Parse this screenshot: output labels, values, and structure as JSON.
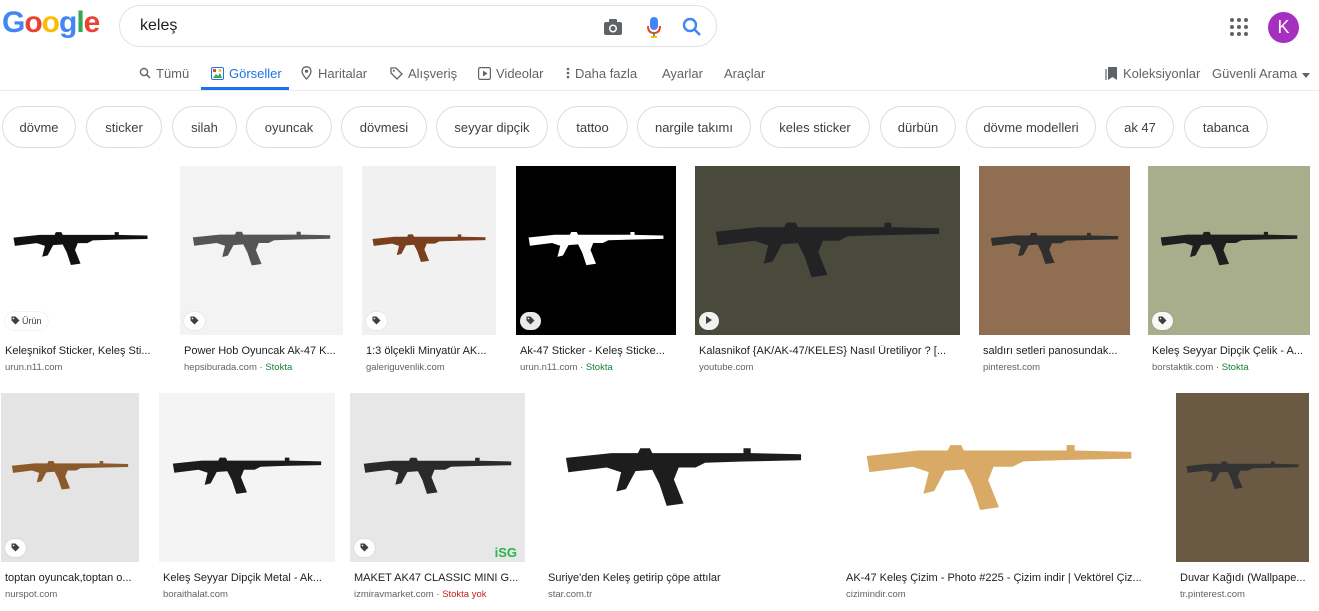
{
  "logo": {
    "letters": [
      "G",
      "o",
      "o",
      "g",
      "l",
      "e"
    ],
    "colors": [
      "#4285f4",
      "#ea4335",
      "#fbbc05",
      "#4285f4",
      "#34a853",
      "#ea4335"
    ]
  },
  "search": {
    "value": "keleş",
    "camera_icon": "camera-icon",
    "mic_icon": "mic-icon",
    "search_icon": "search-icon"
  },
  "user": {
    "initial": "K",
    "avatar_color": "#a52fbf"
  },
  "tabs": [
    {
      "label": "Tümü",
      "icon": "search-icon"
    },
    {
      "label": "Görseller",
      "icon": "image-icon",
      "active": true
    },
    {
      "label": "Haritalar",
      "icon": "map-pin-icon"
    },
    {
      "label": "Alışveriş",
      "icon": "tag-icon"
    },
    {
      "label": "Videolar",
      "icon": "play-icon"
    },
    {
      "label": "Daha fazla",
      "icon": "more-vert-icon"
    },
    {
      "label": "Ayarlar"
    },
    {
      "label": "Araçlar"
    }
  ],
  "right_tools": {
    "collections": "Koleksiyonlar",
    "safesearch": "Güvenli Arama"
  },
  "chips": [
    "dövme",
    "sticker",
    "silah",
    "oyuncak",
    "dövmesi",
    "seyyar dipçik",
    "tattoo",
    "nargile takımı",
    "keles sticker",
    "dürbün",
    "dövme modelleri",
    "ak 47",
    "tabanca"
  ],
  "row1": [
    {
      "caption": "Keleşnikof Sticker, Keleş Sti...",
      "source": "urun.n11.com",
      "badge": "Ürün",
      "badge_icon": "tag-icon",
      "stock": "",
      "bg": "#ffffff",
      "gun": "#111111"
    },
    {
      "caption": "Power Hob Oyuncak Ak-47 K...",
      "source": "hepsiburada.com",
      "stock": " · Stokta",
      "badge_icon": "tag-icon",
      "bg": "#f3f3f3",
      "gun": "#555555"
    },
    {
      "caption": "1:3 ölçekli Minyatür AK...",
      "source": "galeriguvenlik.com",
      "stock": "",
      "badge_icon": "tag-icon",
      "bg": "#f1f1f1",
      "gun": "#7a3f1c"
    },
    {
      "caption": "Ak-47 Sticker - Keleş Sticke...",
      "source": "urun.n11.com",
      "stock": " · Stokta",
      "badge_icon": "tag-icon",
      "bg": "#000000",
      "gun": "#ffffff"
    },
    {
      "caption": "Kalasnikof {AK/AK-47/KELES} Nasıl Üretiliyor ? [...",
      "source": "youtube.com",
      "stock": "",
      "badge_icon": "play-icon",
      "bg": "#4a4a3c",
      "gun": "#232326"
    },
    {
      "caption": "saldırı setleri panosundak...",
      "source": "pinterest.com",
      "stock": "",
      "bg": "#8f6e52",
      "gun": "#2f2f2f"
    },
    {
      "caption": "Keleş Seyyar Dipçik Çelik - A...",
      "source": "borstaktik.com",
      "stock": " · Stokta",
      "badge_icon": "tag-icon",
      "bg": "#a8ad8c",
      "gun": "#1e1e1e"
    }
  ],
  "row2": [
    {
      "caption": "toptan oyuncak,toptan o...",
      "source": "nurspot.com",
      "stock": "",
      "badge_icon": "tag-icon",
      "bg": "#e4e4e4",
      "gun": "#8a5a2b"
    },
    {
      "caption": "Keleş Seyyar Dipçik Metal - Ak...",
      "source": "boraithalat.com",
      "stock": "",
      "bg": "#f4f4f4",
      "gun": "#1b1b1b"
    },
    {
      "caption": "MAKET AK47 CLASSIC MINI G...",
      "source": "izmiravmarket.com",
      "stock": " · Stokta yok",
      "badge_icon": "tag-icon",
      "bg": "#e7e7e7",
      "gun": "#2a2a2a",
      "watermark": "iSG"
    },
    {
      "caption": "Suriye'den Keleş getirip çöpe attılar",
      "source": "star.com.tr",
      "stock": "",
      "bg": "#ffffff",
      "gun": "#1d1d1d"
    },
    {
      "caption": "AK-47 Keleş Çizim - Photo #225 - Çizim indir | Vektörel Çiz...",
      "source": "cizimindir.com",
      "stock": "",
      "bg": "#ffffff",
      "gun": "#d9aa66"
    },
    {
      "caption": "Duvar Kağıdı (Wallpape...",
      "source": "tr.pinterest.com",
      "stock": "",
      "bg": "#6a5a44",
      "gun": "#333333"
    }
  ]
}
